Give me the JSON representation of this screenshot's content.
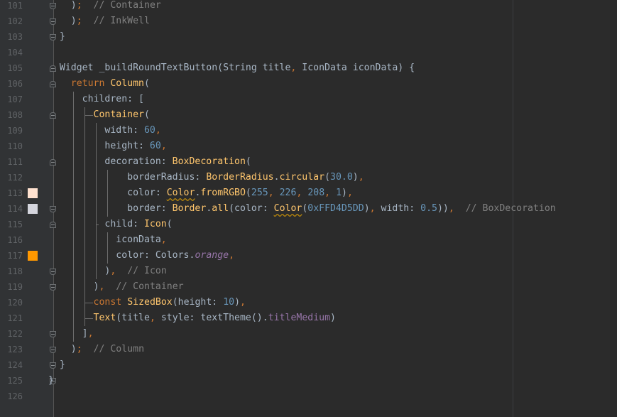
{
  "editor": {
    "lines": [
      {
        "num": "101",
        "text": "    );  // Container"
      },
      {
        "num": "102",
        "text": "    );  // InkWell"
      },
      {
        "num": "103",
        "text": "  }"
      },
      {
        "num": "104",
        "text": ""
      },
      {
        "num": "105",
        "text": "  Widget _buildRoundTextButton(String title, IconData iconData) {"
      },
      {
        "num": "106",
        "text": "    return Column("
      },
      {
        "num": "107",
        "text": "      children: ["
      },
      {
        "num": "108",
        "text": "        Container("
      },
      {
        "num": "109",
        "text": "          width: 60,"
      },
      {
        "num": "110",
        "text": "          height: 60,"
      },
      {
        "num": "111",
        "text": "          decoration: BoxDecoration("
      },
      {
        "num": "112",
        "text": "              borderRadius: BorderRadius.circular(30.0),"
      },
      {
        "num": "113",
        "text": "              color: Color.fromRGBO(255, 226, 208, 1),"
      },
      {
        "num": "114",
        "text": "              border: Border.all(color: Color(0xFFD4D5DD), width: 0.5)),  // BoxDecoration"
      },
      {
        "num": "115",
        "text": "          child: Icon("
      },
      {
        "num": "116",
        "text": "            iconData,"
      },
      {
        "num": "117",
        "text": "            color: Colors.orange,"
      },
      {
        "num": "118",
        "text": "          ),  // Icon"
      },
      {
        "num": "119",
        "text": "        ),  // Container"
      },
      {
        "num": "120",
        "text": "        const SizedBox(height: 10),"
      },
      {
        "num": "121",
        "text": "        Text(title, style: textTheme().titleMedium)"
      },
      {
        "num": "122",
        "text": "      ],"
      },
      {
        "num": "123",
        "text": "    );  // Column"
      },
      {
        "num": "124",
        "text": "  }"
      },
      {
        "num": "125",
        "text": "}"
      },
      {
        "num": "126",
        "text": ""
      }
    ],
    "color_swatches": [
      {
        "line": "113",
        "color": "#FFE2D0"
      },
      {
        "line": "114",
        "color": "#D4D5DD"
      },
      {
        "line": "117",
        "color": "#FF9800"
      }
    ],
    "syntax_colors": {
      "background": "#2B2B2B",
      "gutter": "#313335",
      "keyword": "#CC7832",
      "class": "#FFC66D",
      "number": "#6897BB",
      "comment": "#808080",
      "property": "#9876AA",
      "default": "#A9B7C6"
    }
  }
}
